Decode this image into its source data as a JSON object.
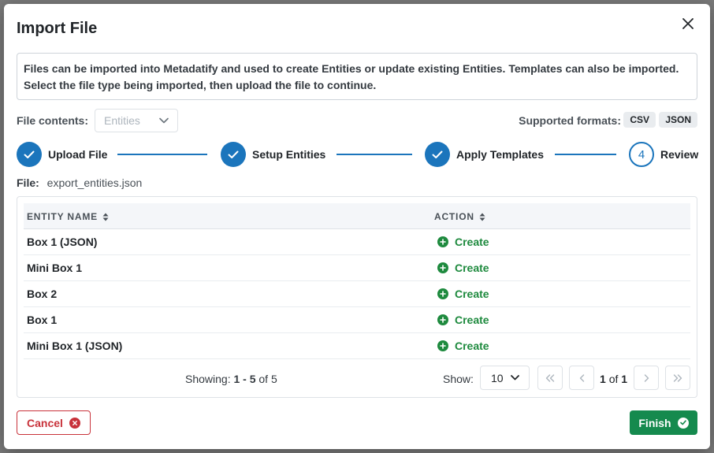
{
  "modal": {
    "title": "Import File",
    "description": "Files can be imported into Metadatify and used to create Entities or update existing Entities. Templates can also be imported. Select the file type being imported, then upload the file to continue."
  },
  "file_contents": {
    "label": "File contents:",
    "selected": "Entities"
  },
  "supported_formats": {
    "label": "Supported formats:",
    "formats": [
      "CSV",
      "JSON"
    ]
  },
  "steps": [
    {
      "label": "Upload File",
      "state": "complete"
    },
    {
      "label": "Setup Entities",
      "state": "complete"
    },
    {
      "label": "Apply Templates",
      "state": "complete"
    },
    {
      "label": "Review",
      "state": "current",
      "number": "4"
    }
  ],
  "file": {
    "label": "File:",
    "name": "export_entities.json"
  },
  "table": {
    "columns": [
      "ENTITY NAME",
      "ACTION"
    ],
    "rows": [
      {
        "name": "Box 1 (JSON)",
        "action": "Create"
      },
      {
        "name": "Mini Box 1",
        "action": "Create"
      },
      {
        "name": "Box 2",
        "action": "Create"
      },
      {
        "name": "Box 1",
        "action": "Create"
      },
      {
        "name": "Mini Box 1 (JSON)",
        "action": "Create"
      }
    ]
  },
  "pagination": {
    "showing_label": "Showing:",
    "showing_range": "1 - 5",
    "showing_of": "of 5",
    "show_label": "Show:",
    "page_size": "10",
    "page_current": "1",
    "page_of": "of",
    "page_total": "1"
  },
  "buttons": {
    "cancel": "Cancel",
    "finish": "Finish"
  },
  "colors": {
    "primary": "#1b75bc",
    "success": "#1e8a3e",
    "danger": "#c8323a",
    "finish_bg": "#158a4e"
  }
}
